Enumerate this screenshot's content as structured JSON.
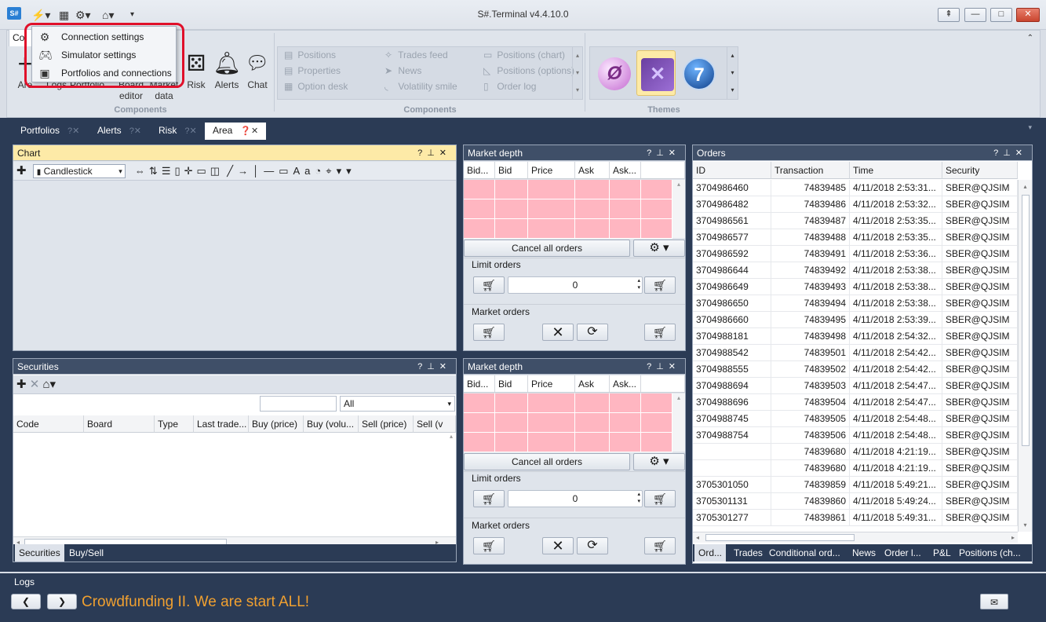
{
  "window": {
    "title": "S#.Terminal v4.4.10.0",
    "app_icon": "S#"
  },
  "dropdown": {
    "items": [
      {
        "label": "Connection settings",
        "icon": "gear-icon"
      },
      {
        "label": "Simulator settings",
        "icon": "gamepad-icon"
      },
      {
        "label": "Portfolios and connections",
        "icon": "briefcase-icon"
      }
    ]
  },
  "ribbon": {
    "file_tab": "Co",
    "buttons_left": [
      {
        "label": "Are",
        "sub": ""
      },
      {
        "label": "Logs",
        "sub": ""
      },
      {
        "label": "Portfolio",
        "sub": ""
      },
      {
        "label": "Board",
        "sub": "editor"
      },
      {
        "label": "Market",
        "sub": "data"
      },
      {
        "label": "Risk",
        "sub": ""
      },
      {
        "label": "Alerts",
        "sub": ""
      },
      {
        "label": "Chat",
        "sub": ""
      }
    ],
    "group1_label": "Components",
    "gallery": {
      "col1": [
        "Positions",
        "Properties",
        "Option desk"
      ],
      "col2": [
        "Trades feed",
        "News",
        "Volatility smile"
      ],
      "col3": [
        "Positions (chart)",
        "Positions (options)",
        "Order log"
      ]
    },
    "group2_label": "Components",
    "themes_label": "Themes",
    "theme_7": "7"
  },
  "doctabs": [
    "Portfolios",
    "Alerts",
    "Risk",
    "Area"
  ],
  "chart": {
    "title": "Chart",
    "chart_type": "Candlestick"
  },
  "market_depth": {
    "title": "Market depth",
    "columns": [
      "Bid...",
      "Bid",
      "Price",
      "Ask",
      "Ask..."
    ],
    "cancel_all": "Cancel all orders",
    "limit_orders": "Limit orders",
    "market_orders": "Market orders",
    "volume": "0"
  },
  "securities": {
    "title": "Securities",
    "filter_value": "All",
    "columns": [
      "Code",
      "Board",
      "Type",
      "Last trade...",
      "Buy (price)",
      "Buy (volu...",
      "Sell (price)",
      "Sell (v"
    ],
    "tabs": [
      "Securities",
      "Buy/Sell"
    ]
  },
  "orders": {
    "title": "Orders",
    "columns": [
      "ID",
      "Transaction",
      "Time",
      "Security"
    ],
    "rows": [
      [
        "3704986460",
        "74839485",
        "4/11/2018 2:53:31...",
        "SBER@QJSIM"
      ],
      [
        "3704986482",
        "74839486",
        "4/11/2018 2:53:32...",
        "SBER@QJSIM"
      ],
      [
        "3704986561",
        "74839487",
        "4/11/2018 2:53:35...",
        "SBER@QJSIM"
      ],
      [
        "3704986577",
        "74839488",
        "4/11/2018 2:53:35...",
        "SBER@QJSIM"
      ],
      [
        "3704986592",
        "74839491",
        "4/11/2018 2:53:36...",
        "SBER@QJSIM"
      ],
      [
        "3704986644",
        "74839492",
        "4/11/2018 2:53:38...",
        "SBER@QJSIM"
      ],
      [
        "3704986649",
        "74839493",
        "4/11/2018 2:53:38...",
        "SBER@QJSIM"
      ],
      [
        "3704986650",
        "74839494",
        "4/11/2018 2:53:38...",
        "SBER@QJSIM"
      ],
      [
        "3704986660",
        "74839495",
        "4/11/2018 2:53:39...",
        "SBER@QJSIM"
      ],
      [
        "3704988181",
        "74839498",
        "4/11/2018 2:54:32...",
        "SBER@QJSIM"
      ],
      [
        "3704988542",
        "74839501",
        "4/11/2018 2:54:42...",
        "SBER@QJSIM"
      ],
      [
        "3704988555",
        "74839502",
        "4/11/2018 2:54:42...",
        "SBER@QJSIM"
      ],
      [
        "3704988694",
        "74839503",
        "4/11/2018 2:54:47...",
        "SBER@QJSIM"
      ],
      [
        "3704988696",
        "74839504",
        "4/11/2018 2:54:47...",
        "SBER@QJSIM"
      ],
      [
        "3704988745",
        "74839505",
        "4/11/2018 2:54:48...",
        "SBER@QJSIM"
      ],
      [
        "3704988754",
        "74839506",
        "4/11/2018 2:54:48...",
        "SBER@QJSIM"
      ],
      [
        "",
        "74839680",
        "4/11/2018 4:21:19...",
        "SBER@QJSIM"
      ],
      [
        "",
        "74839680",
        "4/11/2018 4:21:19...",
        "SBER@QJSIM"
      ],
      [
        "3705301050",
        "74839859",
        "4/11/2018 5:49:21...",
        "SBER@QJSIM"
      ],
      [
        "3705301131",
        "74839860",
        "4/11/2018 5:49:24...",
        "SBER@QJSIM"
      ],
      [
        "3705301277",
        "74839861",
        "4/11/2018 5:49:31...",
        "SBER@QJSIM"
      ]
    ],
    "tabs": [
      "Ord...",
      "Trades",
      "Conditional ord...",
      "News",
      "Order l...",
      "P&L",
      "Positions (ch..."
    ]
  },
  "logs": {
    "title": "Logs",
    "message": "Crowdfunding II. We are start ALL!",
    "message_color": "#f0a030"
  },
  "colors": {
    "frame": "#2b3b55",
    "highlight": "#fdeaa7",
    "pink": "#ffb6c1",
    "red_outline": "#e0102a"
  }
}
